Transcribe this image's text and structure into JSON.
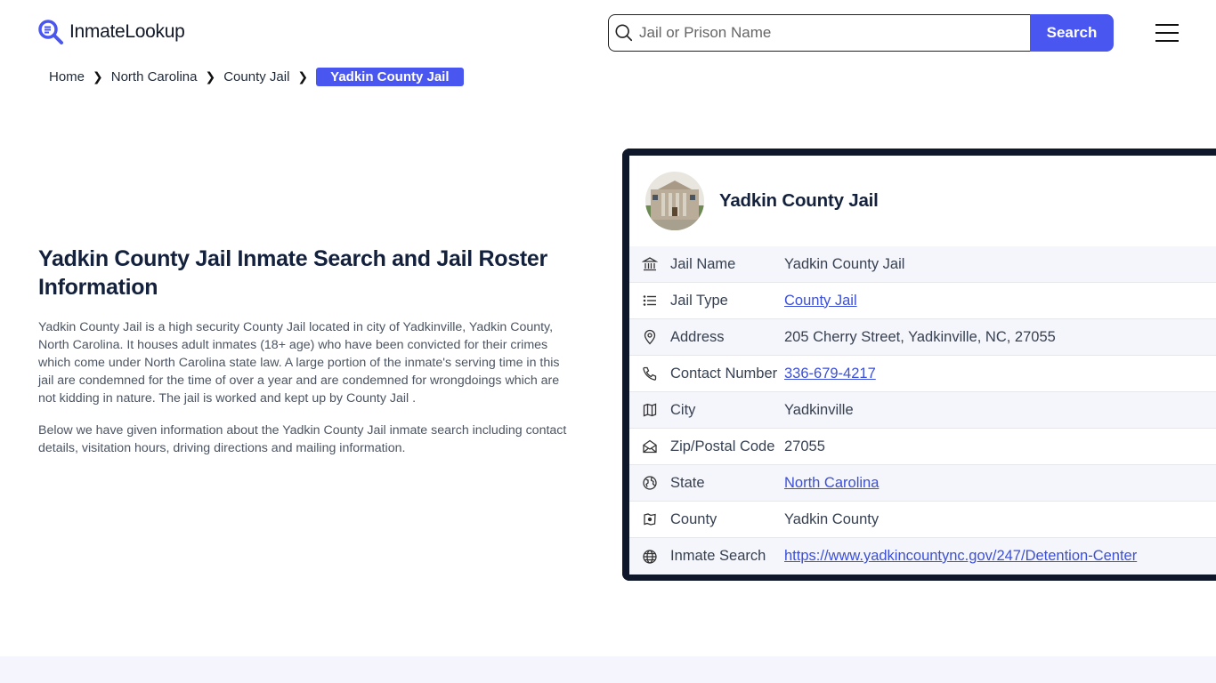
{
  "header": {
    "logo_text": "InmateLookup",
    "search_placeholder": "Jail or Prison Name",
    "search_value": "",
    "search_button": "Search"
  },
  "breadcrumb": {
    "items": [
      "Home",
      "North Carolina",
      "County Jail"
    ],
    "current": "Yadkin County Jail"
  },
  "main": {
    "title": "Yadkin County Jail Inmate Search and Jail Roster Information",
    "paragraph1": "Yadkin County Jail is a high security County Jail located in city of Yadkinville, Yadkin County, North Carolina. It houses adult inmates (18+ age) who have been convicted for their crimes which come under North Carolina state law. A large portion of the inmate's serving time in this jail are condemned for the time of over a year and are condemned for wrongdoings which are not kidding in nature. The jail is worked and kept up by County Jail .",
    "paragraph2": "Below we have given information about the Yadkin County Jail inmate search including contact details, visitation hours, driving directions and mailing information."
  },
  "card": {
    "title": "Yadkin County Jail",
    "rows": [
      {
        "icon": "bank-icon",
        "label": "Jail Name",
        "value": "Yadkin County Jail",
        "link": false
      },
      {
        "icon": "list-icon",
        "label": "Jail Type",
        "value": "County Jail",
        "link": true
      },
      {
        "icon": "map-pin-icon",
        "label": "Address",
        "value": "205 Cherry Street, Yadkinville, NC, 27055",
        "link": false
      },
      {
        "icon": "phone-icon",
        "label": "Contact Number",
        "value": "336-679-4217",
        "link": true
      },
      {
        "icon": "map-icon",
        "label": "City",
        "value": "Yadkinville",
        "link": false
      },
      {
        "icon": "mail-open-icon",
        "label": "Zip/Postal Code",
        "value": "27055",
        "link": false
      },
      {
        "icon": "globe-region-icon",
        "label": "State",
        "value": "North Carolina",
        "link": true
      },
      {
        "icon": "county-map-icon",
        "label": "County",
        "value": "Yadkin County",
        "link": false
      },
      {
        "icon": "globe-icon",
        "label": "Inmate Search",
        "value": "https://www.yadkincountync.gov/247/Detention-Center",
        "link": true
      }
    ]
  },
  "colors": {
    "accent": "#4a56f0",
    "dark": "#0f172a",
    "link": "#3b4fd8",
    "row_alt": "#f5f6fb"
  }
}
